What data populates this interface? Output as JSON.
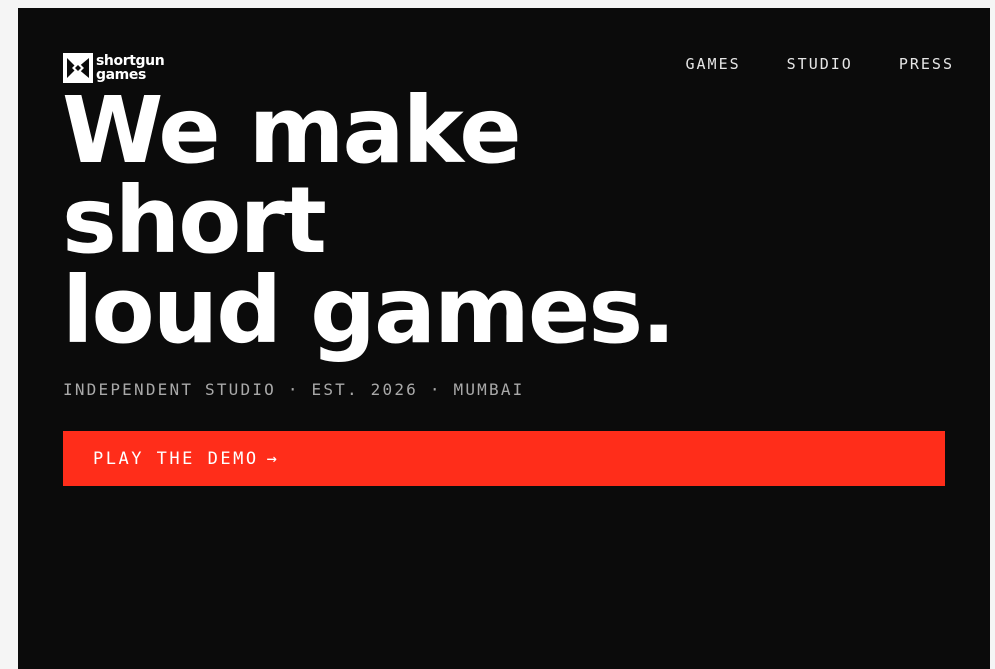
{
  "brand": {
    "logo_line1": "shortgun",
    "logo_line2": "games"
  },
  "nav": {
    "items": [
      {
        "label": "GAMES"
      },
      {
        "label": "STUDIO"
      },
      {
        "label": "PRESS"
      }
    ]
  },
  "hero": {
    "headline_lines": [
      "We make",
      "short",
      "loud games."
    ],
    "tagline": "INDEPENDENT STUDIO · EST. 2026 · MUMBAI",
    "cta_label": "PLAY THE DEMO",
    "cta_arrow": "→"
  },
  "colors": {
    "background": "#0b0b0b",
    "accent": "#ff2d1a",
    "text": "#ffffff",
    "muted": "#a9a9a9"
  }
}
